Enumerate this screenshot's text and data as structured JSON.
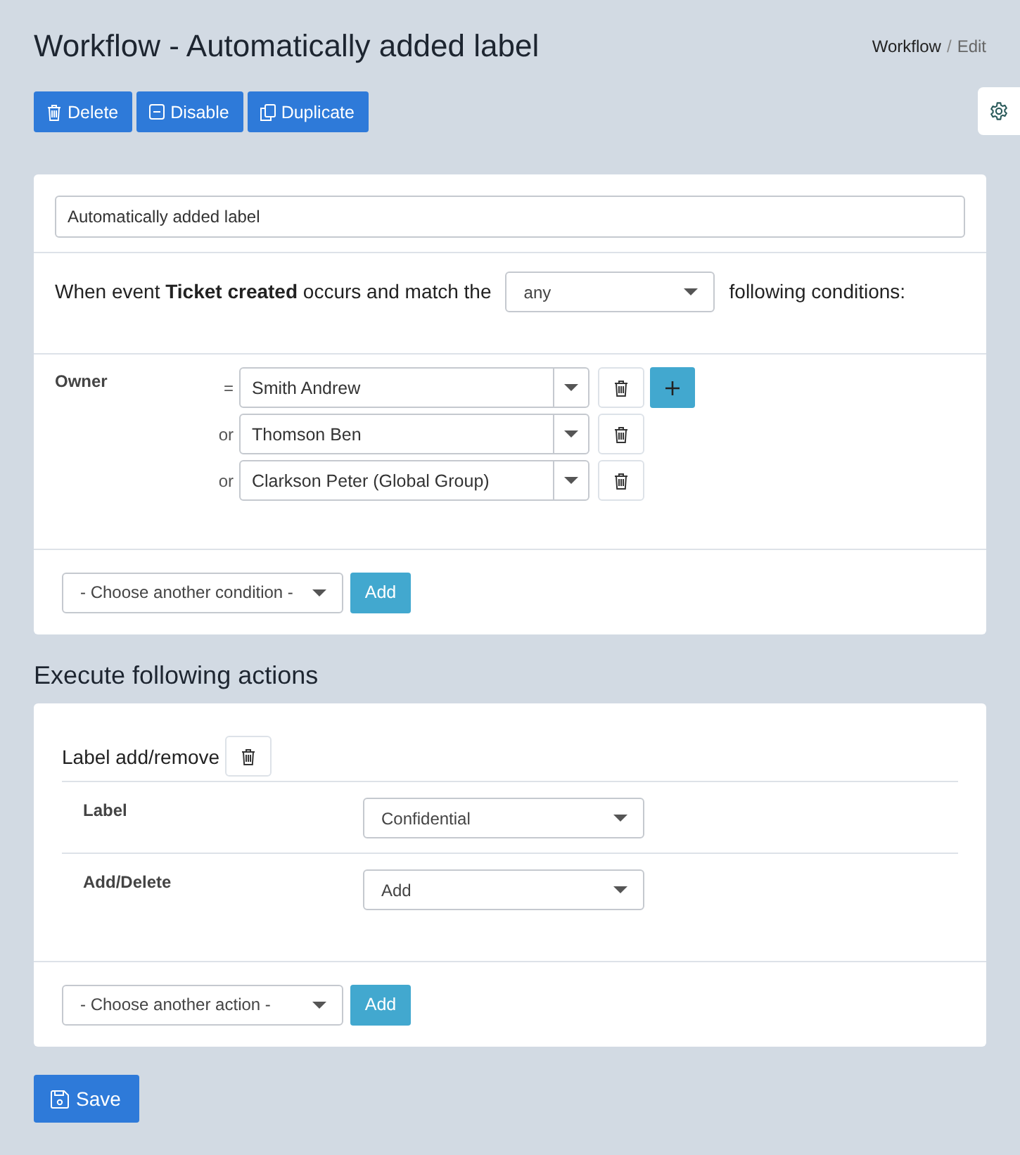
{
  "header": {
    "title": "Workflow - Automatically added label",
    "breadcrumb": [
      {
        "label": "Workflow",
        "selected": false
      },
      {
        "label": "Edit",
        "selected": true
      }
    ],
    "separator": "/"
  },
  "toolbar": [
    {
      "kind": "delete",
      "label": "Delete"
    },
    {
      "kind": "disable",
      "label": "Disable"
    },
    {
      "kind": "duplicate",
      "label": "Duplicate"
    }
  ],
  "name_field": {
    "value": "Automatically added label"
  },
  "trigger": {
    "sentence": "When event **Ticket created** occurs and match the",
    "match": "any",
    "suffix": "following conditions:"
  },
  "conditions": [
    {
      "field": "Owner",
      "rows": [
        {
          "operator": "=",
          "value": "Smith Andrew",
          "add_button": true
        },
        {
          "operator": "or",
          "value": "Thomson Ben",
          "add_button": false
        },
        {
          "operator": "or",
          "value": "Clarkson Peter (Global Group)",
          "add_button": false
        }
      ]
    }
  ],
  "condition_picker": {
    "value": "- Choose another condition -",
    "button": "Add"
  },
  "actions_heading": "Execute following actions",
  "actions": [
    {
      "title": "Label add/remove",
      "fields": [
        {
          "label": "Label",
          "value": "Confidential"
        },
        {
          "label": "Add/Delete",
          "value": "Add"
        }
      ]
    }
  ],
  "action_picker": {
    "value": "- Choose another action -",
    "button": "Add"
  },
  "save_button": "Save"
}
